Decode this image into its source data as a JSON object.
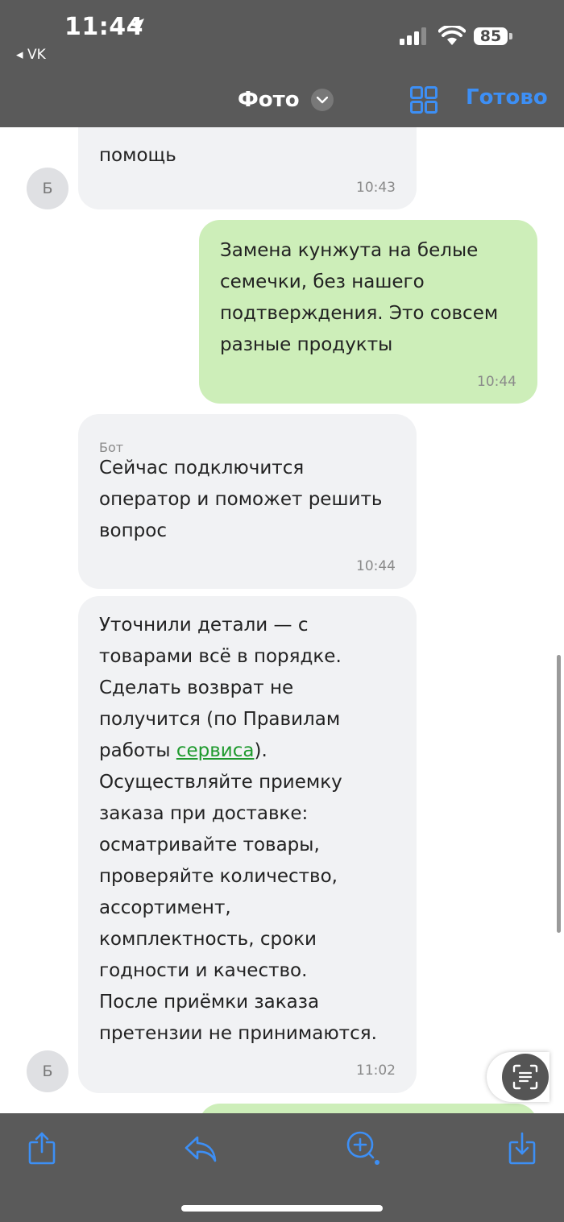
{
  "status_bar": {
    "time": "11:44",
    "back_app": "VK",
    "battery": "85"
  },
  "nav": {
    "title": "Фото",
    "done_label": "Готово"
  },
  "messages": [
    {
      "direction": "incoming",
      "text": "помощь",
      "time": "10:43",
      "avatar": "Б"
    },
    {
      "direction": "outgoing",
      "lines": [
        "Замена кунжута на белые",
        "семечки, без нашего",
        "подтверждения. Это совсем",
        "разные продукты"
      ],
      "time": "10:44"
    },
    {
      "direction": "incoming",
      "sender": "Бот",
      "lines": [
        "Сейчас подключится",
        "оператор и поможет решить",
        "вопрос"
      ],
      "time": "10:44"
    },
    {
      "direction": "incoming",
      "lines": [
        "Уточнили детали — с",
        "товарами всё в порядке.",
        "Сделать возврат не",
        "получится (по Правилам"
      ],
      "line5_prefix": "работы ",
      "link_text": "сервиса",
      "line5_suffix": ").",
      "lines_after": [
        "Осуществляйте приемку",
        "заказа при доставке:",
        "осматривайте товары,",
        "проверяйте количество,",
        "ассортимент,",
        "комплектность, сроки",
        "годности и качество.",
        "После приёмки заказа",
        "претензии не принимаются."
      ],
      "time": "11:02",
      "avatar": "Б"
    }
  ],
  "toolbar": {
    "icons": [
      "share-icon",
      "reply-icon",
      "zoom-in-icon",
      "download-icon"
    ]
  },
  "colors": {
    "bar_bg": "#5a5a5a",
    "accent": "#3d8ff5",
    "incoming_bubble": "#f1f2f4",
    "outgoing_bubble": "#cdeeb9",
    "link": "#1f9a2e"
  }
}
